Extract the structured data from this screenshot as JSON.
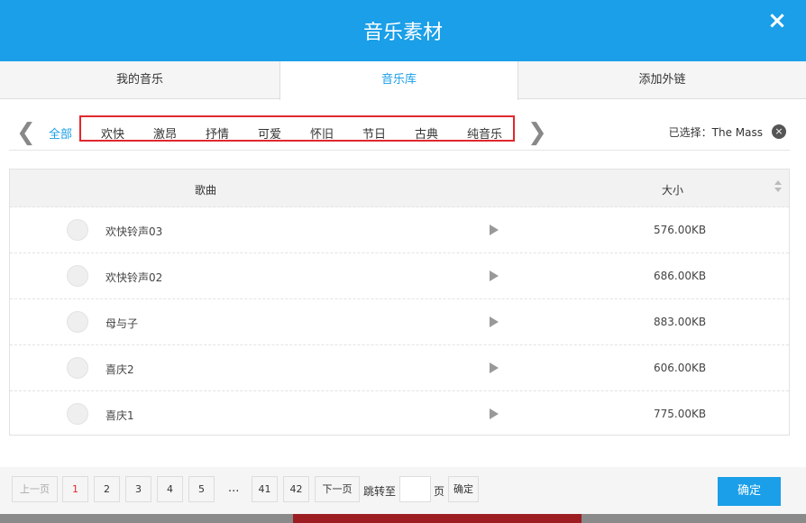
{
  "header": {
    "title": "音乐素材",
    "close_icon": "×"
  },
  "tabs": [
    {
      "label": "我的音乐"
    },
    {
      "label": "音乐库",
      "active": true
    },
    {
      "label": "添加外链"
    }
  ],
  "categories": {
    "prev_icon": "❮",
    "next_icon": "❯",
    "items": [
      {
        "label": "全部",
        "active": true
      },
      {
        "label": "欢快"
      },
      {
        "label": "激昂"
      },
      {
        "label": "抒情"
      },
      {
        "label": "可爱"
      },
      {
        "label": "怀旧"
      },
      {
        "label": "节日"
      },
      {
        "label": "古典"
      },
      {
        "label": "纯音乐"
      }
    ]
  },
  "selection": {
    "text": "已选择：The Mass",
    "clear_icon": "×"
  },
  "table": {
    "headers": {
      "song": "歌曲",
      "size": "大小"
    },
    "rows": [
      {
        "name": "欢快铃声03",
        "size": "576.00KB"
      },
      {
        "name": "欢快铃声02",
        "size": "686.00KB"
      },
      {
        "name": "母与子",
        "size": "883.00KB"
      },
      {
        "name": "喜庆2",
        "size": "606.00KB"
      },
      {
        "name": "喜庆1",
        "size": "775.00KB"
      }
    ]
  },
  "pagination": {
    "prev": "上一页",
    "pages": [
      "1",
      "2",
      "3",
      "4",
      "5"
    ],
    "ellipsis": "...",
    "last_pages": [
      "41",
      "42"
    ],
    "next": "下一页",
    "jump_label": "跳转至",
    "page_unit": "页",
    "jump_confirm": "确定",
    "current_page": 1
  },
  "confirm_button": "确定",
  "colors": {
    "accent": "#1a9fe8",
    "highlight": "#e0282e"
  }
}
